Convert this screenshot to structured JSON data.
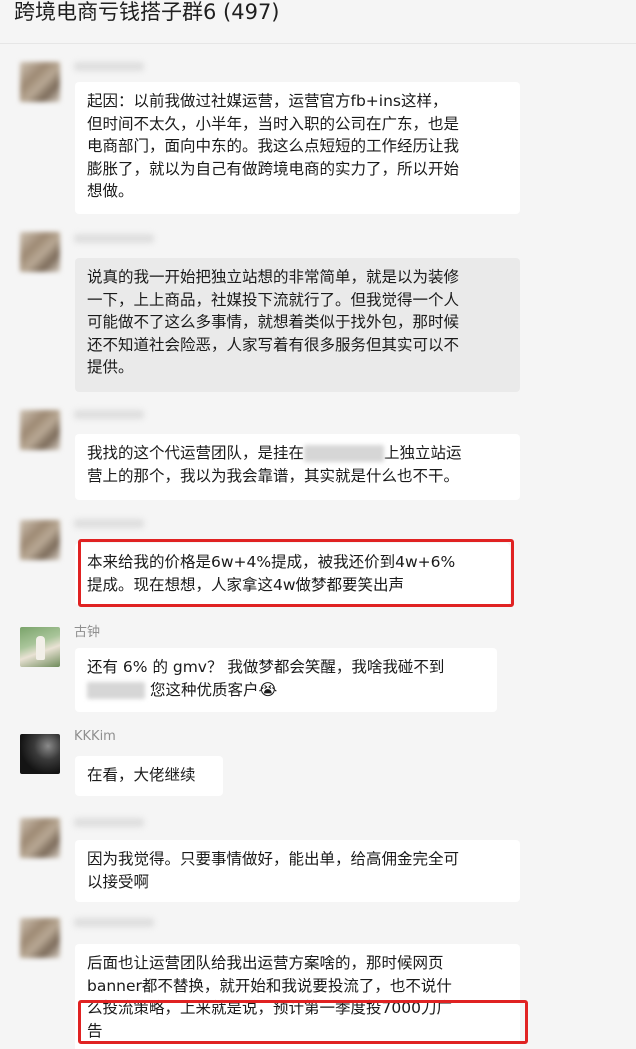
{
  "chat": {
    "title": "跨境电商亏钱搭子群6 (497)"
  },
  "messages": [
    {
      "sender": "",
      "lines": [
        "起因：以前我做过社媒运营，运营官方fb+ins这样，",
        "但时间不太久，小半年，当时入职的公司在广东，也是",
        "电商部门，面向中东的。我这么点短短的工作经历让我",
        "膨胀了，就以为自己有做跨境电商的实力了，所以开始",
        "想做。"
      ]
    },
    {
      "sender": "",
      "lines": [
        "说真的我一开始把独立站想的非常简单，就是以为装修",
        "一下，上上商品，社媒投下流就行了。但我觉得一个人",
        "可能做不了这么多事情，就想着类似于找外包，那时候",
        "还不知道社会险恶，人家写着有很多服务但其实可以不",
        "提供。"
      ]
    },
    {
      "sender": "",
      "line1a": "我找的这个代运营团队，是挂在",
      "line1b": "上独立站运",
      "line2": "营上的那个，我以为我会靠谱，其实就是什么也不干。"
    },
    {
      "sender": "",
      "lines": [
        "本来给我的价格是6w+4%提成，被我还价到4w+6%",
        "提成。现在想想，人家拿这4w做梦都要笑出声"
      ]
    },
    {
      "sender": "古钟",
      "line1": "还有 6% 的 gmv？ 我做梦都会笑醒，我啥我碰不到",
      "line2b": "您这种优质客户",
      "emoji": "😭"
    },
    {
      "sender": "KKKim",
      "text": "在看，大佬继续"
    },
    {
      "sender": "",
      "lines": [
        "因为我觉得。只要事情做好，能出单，给高佣金完全可",
        "以接受啊"
      ]
    },
    {
      "sender": "",
      "lines": [
        "后面也让运营团队给我出运营方案啥的，那时候网页",
        "banner都不替换，就开始和我说要投流了，也不说什",
        "么投流策略，上来就是说，预计第一季度投7000刀广",
        "告"
      ]
    }
  ]
}
